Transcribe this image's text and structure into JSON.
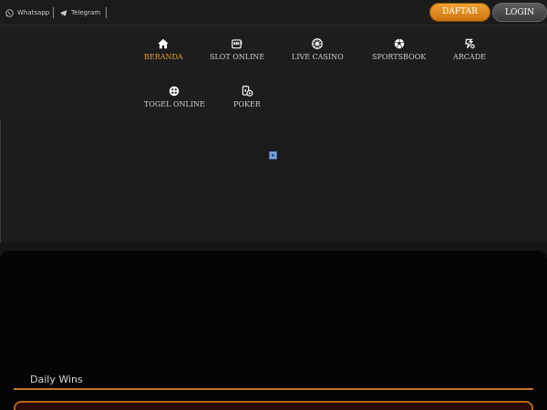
{
  "topbar": {
    "whatsapp_label": "Whatsapp",
    "telegram_label": "Telegram",
    "daftar_label": "DAFTAR",
    "login_label": "LOGIN"
  },
  "nav": {
    "items": [
      {
        "label": "BERANDA",
        "icon": "home-icon",
        "active": true
      },
      {
        "label": "SLOT ONLINE",
        "icon": "slot-machine-icon",
        "active": false
      },
      {
        "label": "LIVE CASINO",
        "icon": "roulette-icon",
        "active": false
      },
      {
        "label": "SPORTSBOOK",
        "icon": "soccer-ball-icon",
        "active": false
      },
      {
        "label": "ARCADE",
        "icon": "arcade-icon",
        "active": false
      },
      {
        "label": "TOGEL ONLINE",
        "icon": "lottery-ball-icon",
        "active": false
      },
      {
        "label": "POKER",
        "icon": "poker-cards-icon",
        "active": false
      }
    ]
  },
  "daily_wins": {
    "title": "Daily Wins"
  },
  "colors": {
    "accent": "#e79a2d",
    "daftar_gradient_top": "#f4a534",
    "daftar_gradient_bottom": "#c8710e",
    "background": "#161616"
  }
}
